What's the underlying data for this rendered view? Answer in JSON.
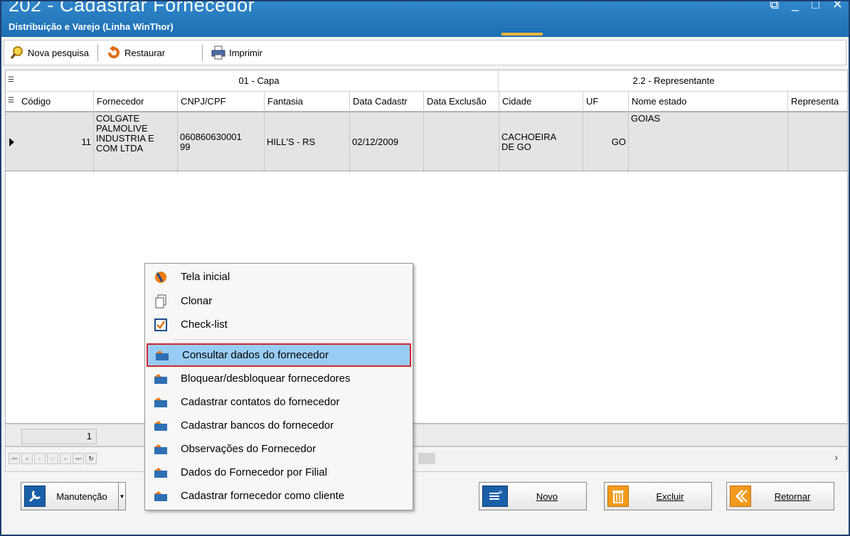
{
  "window": {
    "title": "202 - Cadastrar Fornecedor",
    "subtitle": "Distribuição e Varejo (Linha WinThor)",
    "controls": [
      "⧉",
      "_",
      "□",
      "✕"
    ]
  },
  "toolbar": {
    "nova_pesquisa": "Nova pesquisa",
    "restaurar": "Restaurar",
    "imprimir": "Imprimir"
  },
  "grid": {
    "bands": [
      "01 - Capa",
      "2.2 - Representante"
    ],
    "columns": [
      "Código",
      "Fornecedor",
      "CNPJ/CPF",
      "Fantasia",
      "Data Cadastr",
      "Data Exclusão",
      "Cidade",
      "UF",
      "Nome estado",
      "Representa"
    ],
    "rows": [
      {
        "codigo": "11",
        "fornecedor": "COLGATE\nPALMOLIVE\nINDUSTRIA E\nCOM LTDA",
        "cnpj": "060860630001\n99",
        "fantasia": "HILL'S - RS",
        "data_cadastro": "02/12/2009",
        "data_exclusao": "",
        "cidade": "CACHOEIRA\nDE GO",
        "uf": "GO",
        "nome_estado": "GOIAS",
        "representante": ""
      }
    ],
    "record_count": "1"
  },
  "context_menu": {
    "items": [
      "Tela inicial",
      "Clonar",
      "Check-list",
      "Consultar dados do fornecedor",
      "Bloquear/desbloquear fornecedores",
      "Cadastrar contatos do fornecedor",
      "Cadastrar bancos do fornecedor",
      "Observações do Fornecedor",
      "Dados do Fornecedor por Filial",
      "Cadastrar fornecedor como cliente"
    ],
    "highlighted": "Consultar dados do fornecedor"
  },
  "buttons": {
    "manutencao": "Manutenção",
    "novo": "Novo",
    "excluir": "Excluir",
    "retornar": "Retornar"
  },
  "colors": {
    "title_bar": "#1e6fb3",
    "highlight": "#99ccf4",
    "highlight_border": "#d4262e"
  }
}
